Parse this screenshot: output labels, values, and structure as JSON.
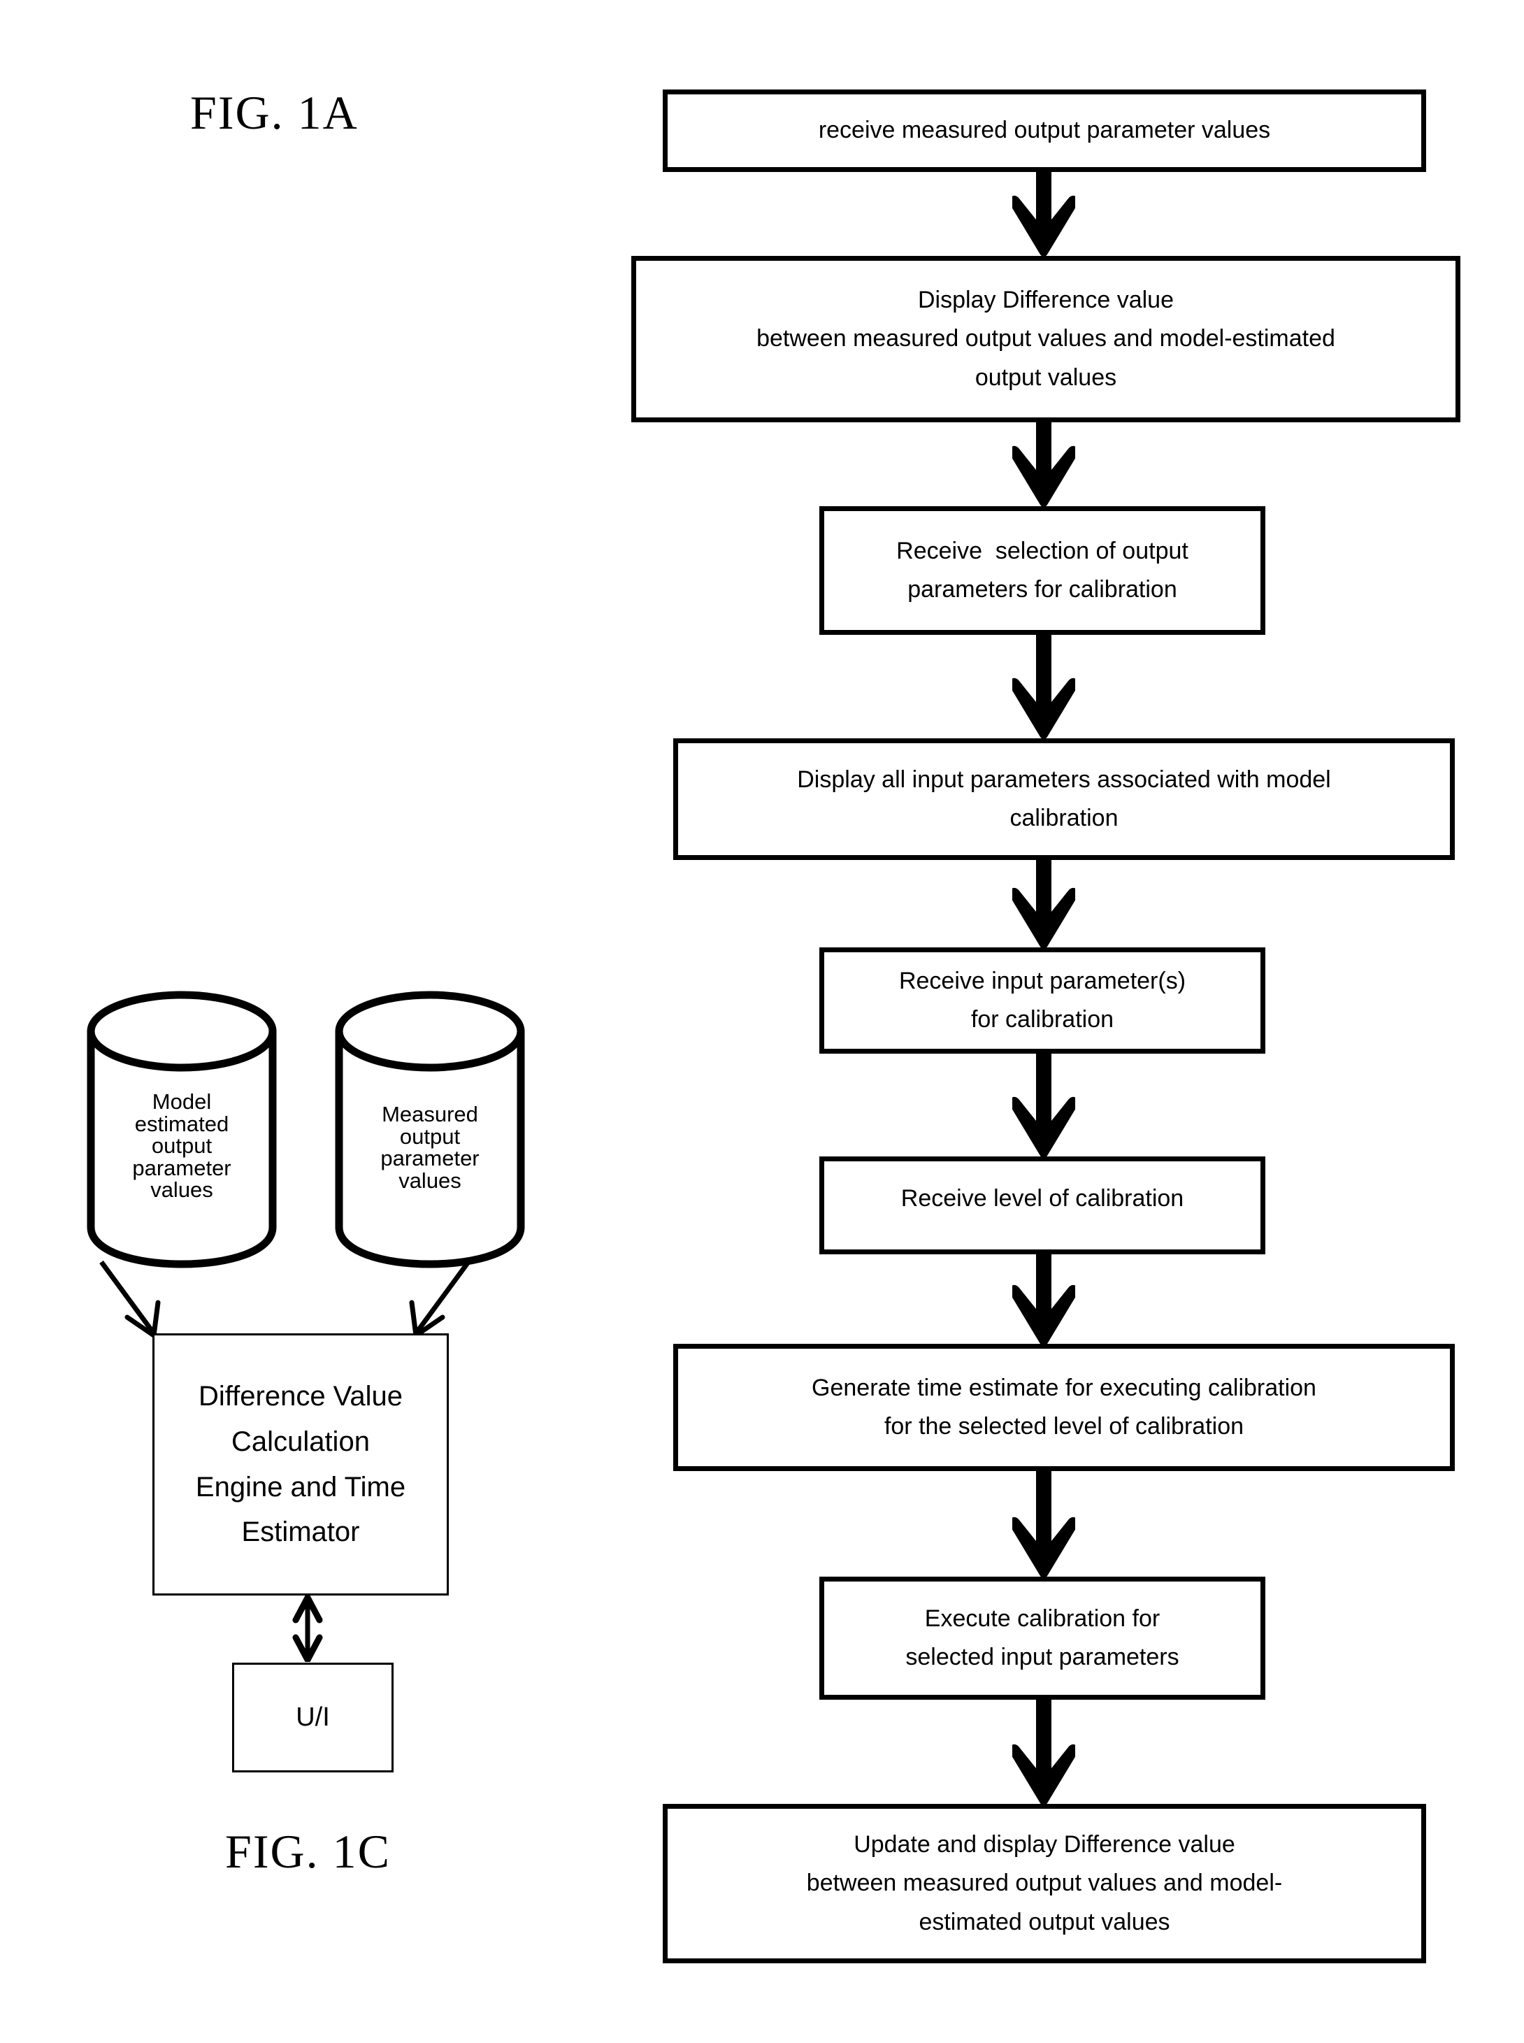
{
  "figures": {
    "fig_1a_label": "FIG. 1A",
    "fig_1c_label": "FIG. 1C"
  },
  "flowchart": {
    "name": "FIG. 1A",
    "orientation": "top-to-bottom",
    "connector_icon": "down-block-arrow-icon",
    "steps": [
      {
        "id": "receive-measured-output",
        "lines": [
          "receive measured output parameter values"
        ]
      },
      {
        "id": "display-difference-value",
        "lines": [
          "Display Difference value",
          "between measured output values and model-estimated",
          "output values"
        ]
      },
      {
        "id": "receive-selection-output-params",
        "lines": [
          "Receive  selection of output",
          "parameters for calibration"
        ]
      },
      {
        "id": "display-all-input-params",
        "lines": [
          "Display all input parameters associated with model",
          "calibration"
        ]
      },
      {
        "id": "receive-input-params",
        "lines": [
          "Receive input parameter(s)",
          "for calibration"
        ]
      },
      {
        "id": "receive-level-of-calibration",
        "lines": [
          "Receive level of calibration"
        ]
      },
      {
        "id": "generate-time-estimate",
        "lines": [
          "Generate time estimate for executing calibration",
          "for the selected level of calibration"
        ]
      },
      {
        "id": "execute-calibration",
        "lines": [
          "Execute calibration for",
          "selected input parameters"
        ]
      },
      {
        "id": "update-display-difference-value",
        "lines": [
          "Update and display Difference value",
          "between measured output values and model-",
          "estimated output values"
        ]
      }
    ]
  },
  "architecture": {
    "name": "FIG. 1C",
    "datastores": [
      {
        "id": "model-estimated-datastore",
        "icon": "database-cylinder-icon",
        "lines": [
          "Model",
          "estimated",
          "output",
          "parameter",
          "values"
        ]
      },
      {
        "id": "measured-datastore",
        "icon": "database-cylinder-icon",
        "lines": [
          "Measured",
          "output",
          "parameter",
          "values"
        ]
      }
    ],
    "engine": {
      "id": "difference-value-engine",
      "lines": [
        "Difference Value",
        "Calculation",
        "Engine and Time",
        "Estimator"
      ]
    },
    "ui": {
      "id": "user-interface-block",
      "lines": [
        "U/I"
      ]
    },
    "connectors": [
      {
        "id": "model-to-engine",
        "icon": "diagonal-arrow-icon",
        "direction": "down-right"
      },
      {
        "id": "measured-to-engine",
        "icon": "diagonal-arrow-icon",
        "direction": "down-left"
      },
      {
        "id": "engine-to-ui",
        "icon": "double-headed-arrow-icon",
        "direction": "bidirectional-vertical"
      }
    ]
  },
  "colors": {
    "ink": "#000000",
    "paper": "#ffffff"
  }
}
